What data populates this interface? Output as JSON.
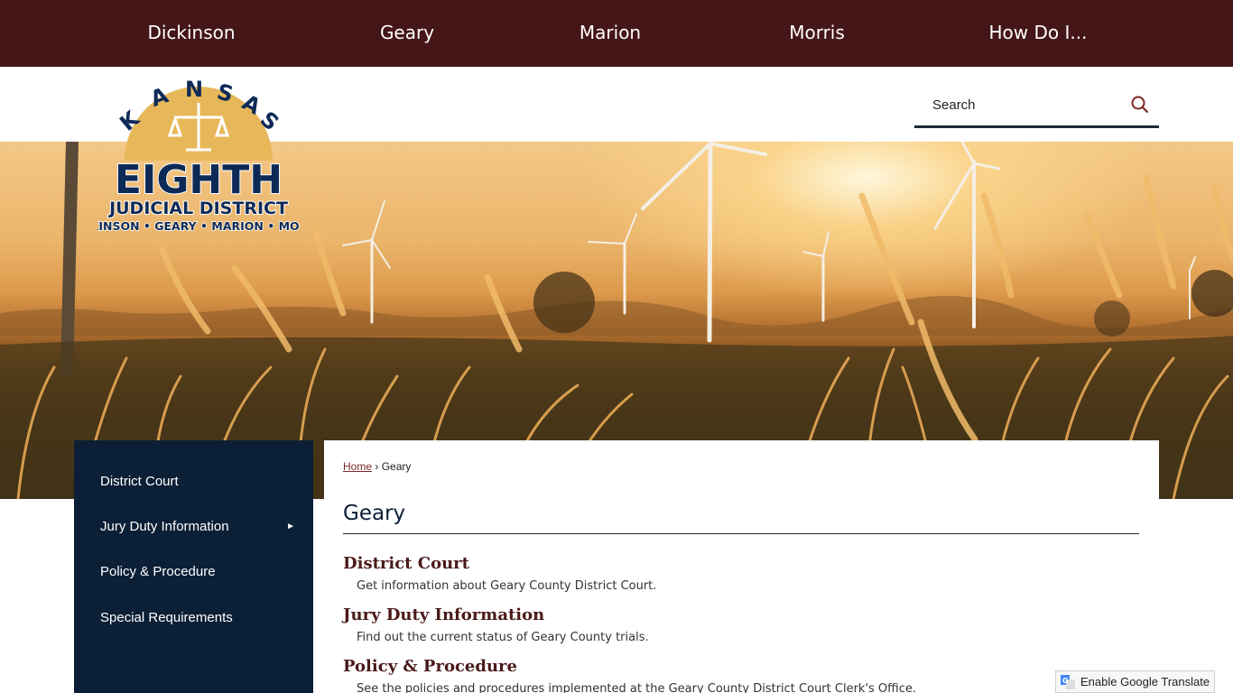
{
  "topnav": {
    "items": [
      {
        "label": "Dickinson"
      },
      {
        "label": "Geary"
      },
      {
        "label": "Marion"
      },
      {
        "label": "Morris"
      },
      {
        "label": "How Do I..."
      }
    ]
  },
  "logo": {
    "line1": "KANSAS",
    "line2": "EIGHTH",
    "line3": "JUDICIAL DISTRICT",
    "line4": "DICKINSON • GEARY • MARION • MORRIS"
  },
  "search": {
    "placeholder": "Search",
    "icon": "search-icon"
  },
  "sidenav": {
    "items": [
      {
        "label": "District Court",
        "has_submenu": false
      },
      {
        "label": "Jury Duty Information",
        "has_submenu": true,
        "arrow": "►"
      },
      {
        "label": "Policy & Procedure",
        "has_submenu": false
      },
      {
        "label": "Special Requirements",
        "has_submenu": false
      }
    ]
  },
  "breadcrumb": {
    "home": "Home",
    "separator": "›",
    "current": "Geary"
  },
  "main": {
    "title": "Geary",
    "entries": [
      {
        "title": "District Court",
        "description": "Get information about Geary County District Court."
      },
      {
        "title": "Jury Duty Information",
        "description": "Find out the current status of Geary County trials."
      },
      {
        "title": "Policy & Procedure",
        "description": "See the policies and procedures implemented at the Geary County District Court Clerk's Office."
      }
    ]
  },
  "translate": {
    "label": "Enable Google Translate",
    "icon": "google-translate-icon"
  },
  "colors": {
    "topnav_bg": "#451617",
    "sidenav_bg": "#0b1f36",
    "link": "#7a2a24",
    "heading": "#4a1a1a",
    "logo_navy": "#0d2a57",
    "logo_gold": "#e7b85a"
  }
}
